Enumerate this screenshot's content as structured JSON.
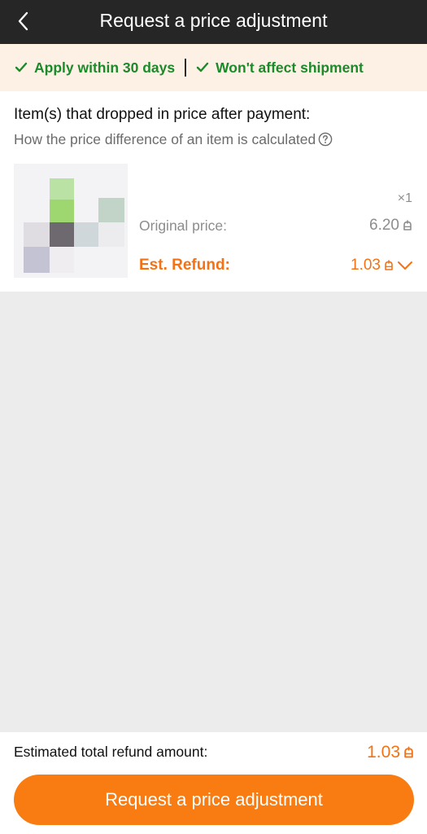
{
  "header": {
    "title": "Request a price adjustment",
    "back_icon": "chevron-left-icon"
  },
  "guarantees": {
    "items": [
      {
        "label": "Apply within 30 days",
        "icon": "check-icon"
      },
      {
        "label": "Won't affect shipment",
        "icon": "check-icon"
      }
    ],
    "color": "#1b8a2a"
  },
  "items_section": {
    "title": "Item(s) that dropped in price after payment:",
    "calc_link": "How the price difference of an item is calculated",
    "help_icon": "question-circle-icon"
  },
  "item": {
    "quantity": "×1",
    "original_price_label": "Original price:",
    "original_price_value": "6.20",
    "refund_label": "Est. Refund:",
    "refund_value": "1.03",
    "currency_icon": "baht-icon",
    "expand_icon": "chevron-down-icon"
  },
  "footer": {
    "total_label": "Estimated total refund amount:",
    "total_value": "1.03",
    "button_label": "Request a price adjustment"
  },
  "colors": {
    "accent": "#f97c12",
    "refund_text": "#f47214",
    "topbar": "#262626",
    "banner_bg": "#fdf0e4"
  }
}
